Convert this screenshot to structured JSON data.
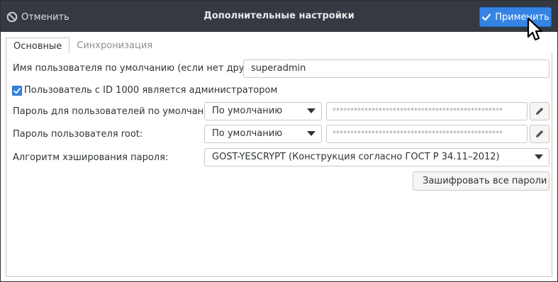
{
  "window": {
    "title": "Дополнительные настройки",
    "cancel_label": "Отменить",
    "apply_label": "Применить"
  },
  "tabs": [
    {
      "label": "Основные",
      "active": true
    },
    {
      "label": "Синхронизация",
      "active": false
    }
  ],
  "form": {
    "default_user_label": "Имя пользователя по умолчанию (если нет других):",
    "default_user_value": "superadmin",
    "admin_checkbox_label": "Пользователь с ID 1000 является администратором",
    "admin_checkbox_checked": true,
    "default_password_label": "Пароль для пользователей по умолчанию:",
    "default_password_combo": "По умолчанию",
    "default_password_mask": "************************************************",
    "root_password_label": "Пароль пользователя root:",
    "root_password_combo": "По умолчанию",
    "root_password_mask": "************************************************",
    "hash_algorithm_label": "Алгоритм хэширования пароля:",
    "hash_algorithm_value": "GOST-YESCRYPT (Конструкция согласно ГОСТ Р 34.11–2012)",
    "encrypt_all_label": "Зашифровать все пароли"
  },
  "icons": {
    "cancel": "cancel-circle-icon",
    "apply": "check-icon",
    "combo": "chevron-down-icon",
    "edit": "pencil-icon",
    "lock": "lock-icon",
    "cursor": "mouse-pointer-icon"
  },
  "colors": {
    "titlebar": "#353a42",
    "accent": "#3584e4",
    "border": "#cdc7c2"
  }
}
